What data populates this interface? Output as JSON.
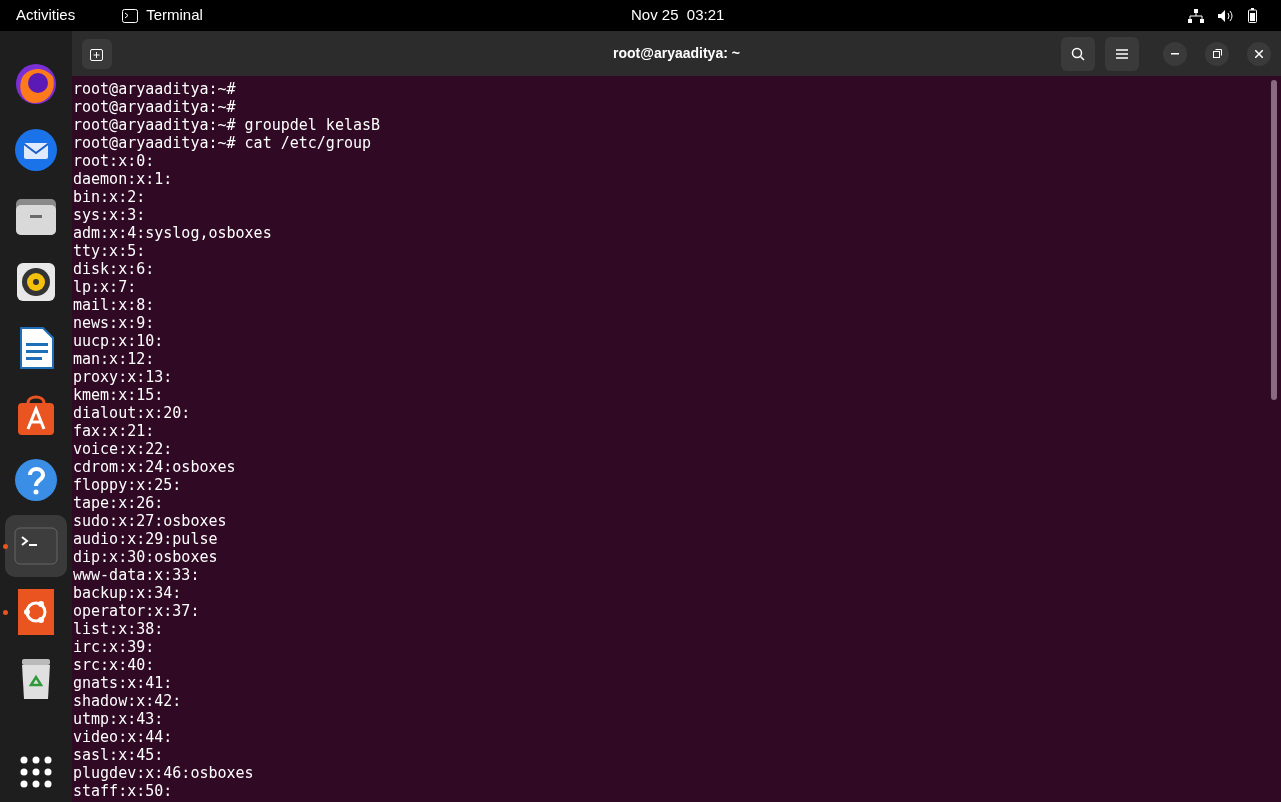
{
  "top_bar": {
    "activities": "Activities",
    "app_name": "Terminal",
    "clock": "Nov 25  03:21"
  },
  "dock": {
    "items": [
      {
        "kind": "firefox",
        "selected": false,
        "running": false
      },
      {
        "kind": "thunderbird",
        "selected": false,
        "running": false
      },
      {
        "kind": "files",
        "selected": false,
        "running": false
      },
      {
        "kind": "rhythmbox",
        "selected": false,
        "running": false
      },
      {
        "kind": "writer",
        "selected": false,
        "running": false
      },
      {
        "kind": "appstore",
        "selected": false,
        "running": false
      },
      {
        "kind": "help",
        "selected": false,
        "running": false
      },
      {
        "kind": "terminal",
        "selected": true,
        "running": true
      },
      {
        "kind": "ubuntu",
        "selected": false,
        "running": true
      },
      {
        "kind": "trash",
        "selected": false,
        "running": false
      }
    ]
  },
  "window": {
    "title": "root@aryaaditya: ~"
  },
  "terminal": {
    "lines": [
      "root@aryaaditya:~#",
      "root@aryaaditya:~#",
      "root@aryaaditya:~# groupdel kelasB",
      "root@aryaaditya:~# cat /etc/group",
      "root:x:0:",
      "daemon:x:1:",
      "bin:x:2:",
      "sys:x:3:",
      "adm:x:4:syslog,osboxes",
      "tty:x:5:",
      "disk:x:6:",
      "lp:x:7:",
      "mail:x:8:",
      "news:x:9:",
      "uucp:x:10:",
      "man:x:12:",
      "proxy:x:13:",
      "kmem:x:15:",
      "dialout:x:20:",
      "fax:x:21:",
      "voice:x:22:",
      "cdrom:x:24:osboxes",
      "floppy:x:25:",
      "tape:x:26:",
      "sudo:x:27:osboxes",
      "audio:x:29:pulse",
      "dip:x:30:osboxes",
      "www-data:x:33:",
      "backup:x:34:",
      "operator:x:37:",
      "list:x:38:",
      "irc:x:39:",
      "src:x:40:",
      "gnats:x:41:",
      "shadow:x:42:",
      "utmp:x:43:",
      "video:x:44:",
      "sasl:x:45:",
      "plugdev:x:46:osboxes",
      "staff:x:50:"
    ]
  }
}
